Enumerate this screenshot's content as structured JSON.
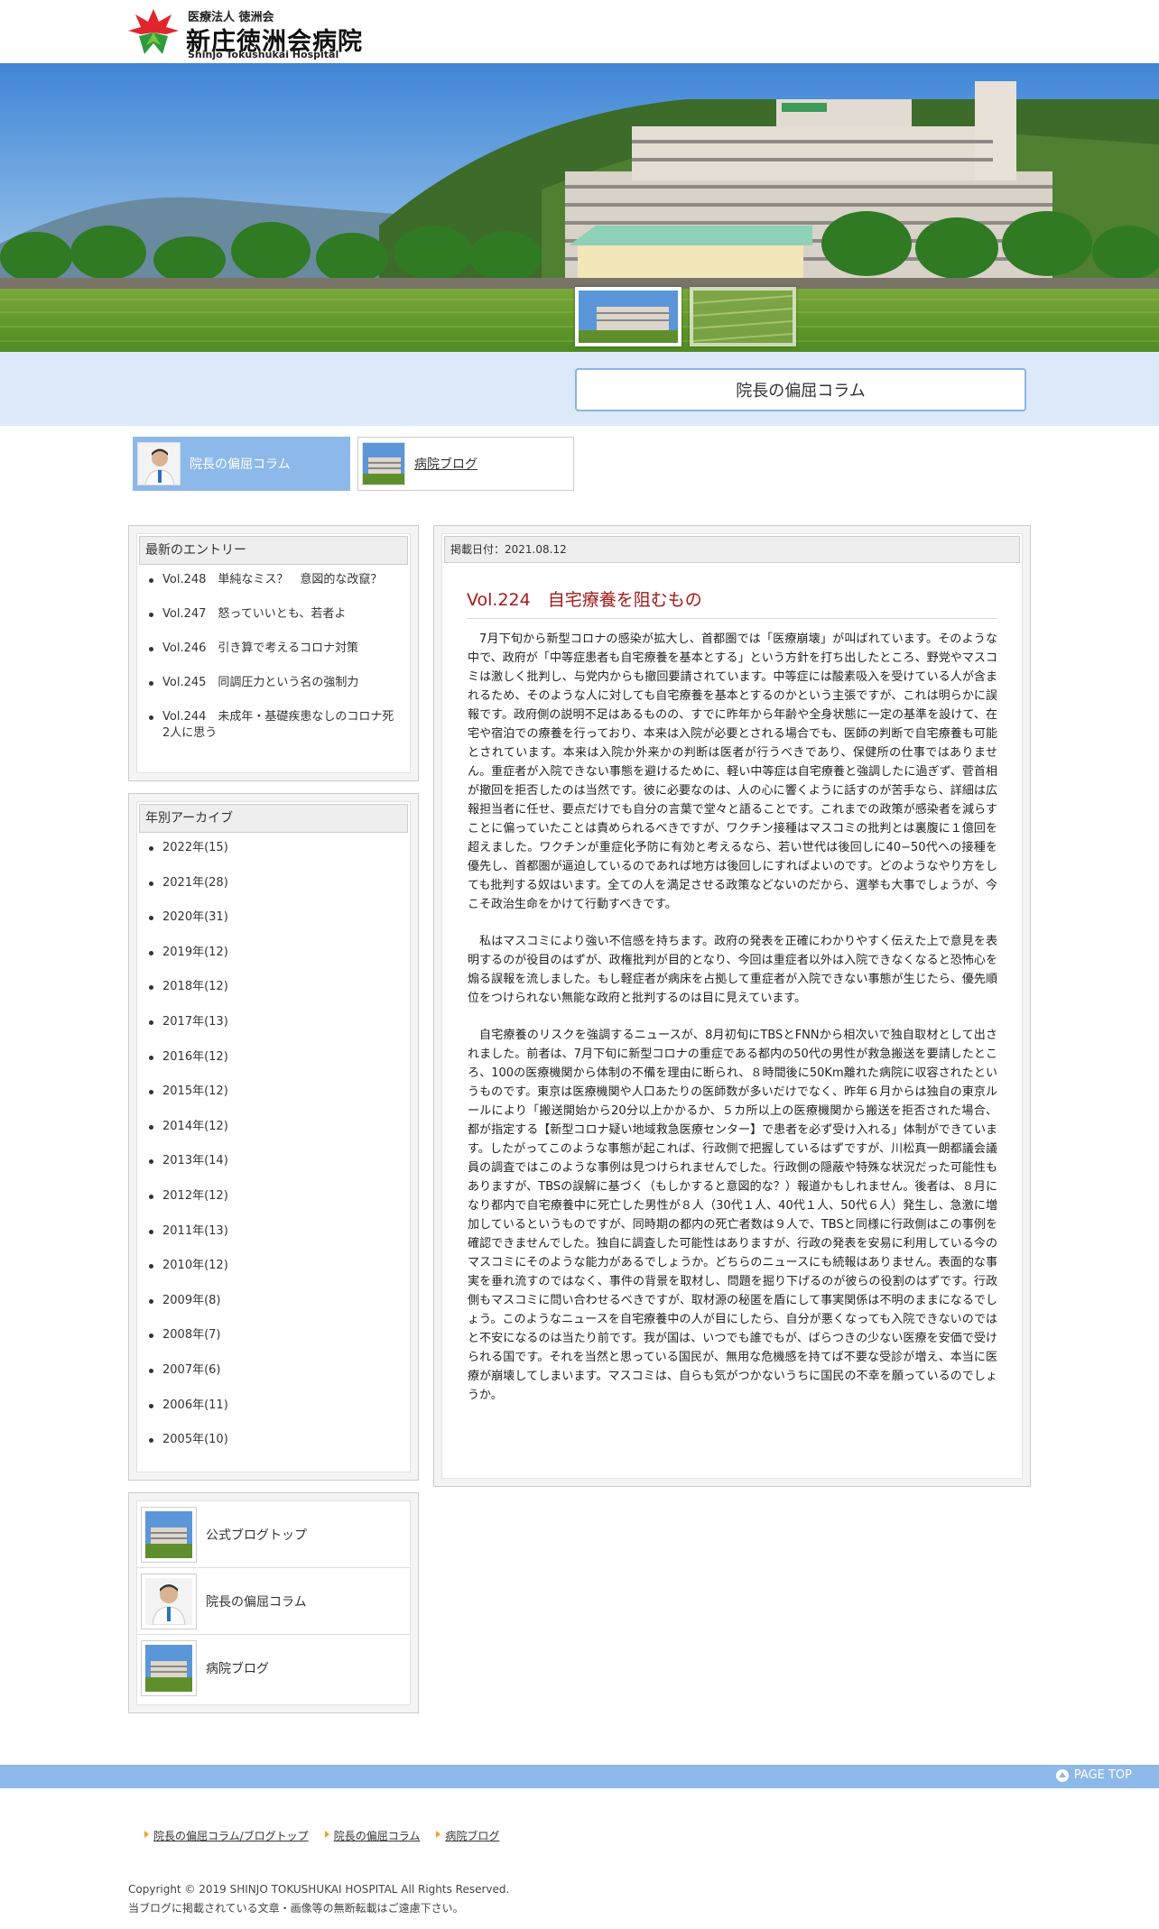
{
  "header": {
    "org": "医療法人 徳洲会",
    "name": "新庄徳洲会病院",
    "name_en": "Shinjo Tokushukai Hospital"
  },
  "band": {
    "title": "院長の偏屈コラム"
  },
  "tabs": [
    {
      "label": "院長の偏屈コラム",
      "active": true
    },
    {
      "label": "病院ブログ",
      "active": false
    }
  ],
  "entries": {
    "heading": "最新のエントリー",
    "items": [
      "Vol.248　単純なミス？　意図的な改竄？",
      "Vol.247　怒っていいとも、若者よ",
      "Vol.246　引き算で考えるコロナ対策",
      "Vol.245　同調圧力という名の強制力",
      "Vol.244　未成年・基礎疾患なしのコロナ死2人に思う"
    ]
  },
  "archive": {
    "heading": "年別アーカイブ",
    "items": [
      "2022年(15)",
      "2021年(28)",
      "2020年(31)",
      "2019年(12)",
      "2018年(12)",
      "2017年(13)",
      "2016年(12)",
      "2015年(12)",
      "2014年(12)",
      "2013年(14)",
      "2012年(12)",
      "2011年(13)",
      "2010年(12)",
      "2009年(8)",
      "2008年(7)",
      "2007年(6)",
      "2006年(11)",
      "2005年(10)"
    ]
  },
  "links": [
    "公式ブログトップ",
    "院長の偏屈コラム",
    "病院ブログ"
  ],
  "article": {
    "date": "掲載日付：2021.08.12",
    "title": "Vol.224　自宅療養を阻むもの",
    "paragraphs": [
      "7月下旬から新型コロナの感染が拡大し、首都圏では「医療崩壊」が叫ばれています。そのような中で、政府が「中等症患者も自宅療養を基本とする」という方針を打ち出したところ、野党やマスコミは激しく批判し、与党内からも撤回要請されています。中等症には酸素吸入を受けている人が含まれるため、そのような人に対しても自宅療養を基本とするのかという主張ですが、これは明らかに誤報です。政府側の説明不足はあるものの、すでに昨年から年齢や全身状態に一定の基準を設けて、在宅や宿泊での療養を行っており、本来は入院が必要とされる場合でも、医師の判断で自宅療養も可能とされています。本来は入院か外来かの判断は医者が行うべきであり、保健所の仕事ではありません。重症者が入院できない事態を避けるために、軽い中等症は自宅療養と強調したに過ぎず、菅首相が撤回を拒否したのは当然です。彼に必要なのは、人の心に響くように話すのが苦手なら、詳細は広報担当者に任せ、要点だけでも自分の言葉で堂々と語ることです。これまでの政策が感染者を減らすことに偏っていたことは責められるべきですが、ワクチン接種はマスコミの批判とは裏腹に１億回を超えました。ワクチンが重症化予防に有効と考えるなら、若い世代は後回しに40−50代への接種を優先し、首都圏が逼迫しているのであれば地方は後回しにすればよいのです。どのようなやり方をしても批判する奴はいます。全ての人を満足させる政策などないのだから、選挙も大事でしょうが、今こそ政治生命をかけて行動すべきです。",
      "私はマスコミにより強い不信感を持ちます。政府の発表を正確にわかりやすく伝えた上で意見を表明するのが役目のはずが、政権批判が目的となり、今回は重症者以外は入院できなくなると恐怖心を煽る誤報を流しました。もし軽症者が病床を占拠して重症者が入院できない事態が生じたら、優先順位をつけられない無能な政府と批判するのは目に見えています。",
      "自宅療養のリスクを強調するニュースが、8月初旬にTBSとFNNから相次いで独自取材として出されました。前者は、7月下旬に新型コロナの重症である都内の50代の男性が救急搬送を要請したところ、100の医療機関から体制の不備を理由に断られ、８時間後に50Km離れた病院に収容されたというものです。東京は医療機関や人口あたりの医師数が多いだけでなく、昨年６月からは独自の東京ルールにより「搬送開始から20分以上かかるか、５カ所以上の医療機関から搬送を拒否された場合、都が指定する【新型コロナ疑い地域救急医療センター】で患者を必ず受け入れる」体制ができています。したがってこのような事態が起これば、行政側で把握しているはずですが、川松真一朗都議会議員の調査ではこのような事例は見つけられませんでした。行政側の隠蔽や特殊な状況だった可能性もありますが、TBSの誤解に基づく（もしかすると意図的な？）報道かもしれません。後者は、８月になり都内で自宅療養中に死亡した男性が８人（30代１人、40代１人、50代６人）発生し、急激に増加しているというものですが、同時期の都内の死亡者数は９人で、TBSと同様に行政側はこの事例を確認できませんでした。独自に調査した可能性はありますが、行政の発表を安易に利用している今のマスコミにそのような能力があるでしょうか。どちらのニュースにも続報はありません。表面的な事実を垂れ流すのではなく、事件の背景を取材し、問題を掘り下げるのが彼らの役割のはずです。行政側もマスコミに問い合わせるべきですが、取材源の秘匿を盾にして事実関係は不明のままになるでしょう。このようなニュースを自宅療養中の人が目にしたら、自分が悪くなっても入院できないのではと不安になるのは当たり前です。我が国は、いつでも誰でもが、ばらつきの少ない医療を安価で受けられる国です。それを当然と思っている国民が、無用な危機感を持てば不要な受診が増え、本当に医療が崩壊してしまいます。マスコミは、自らも気がつかないうちに国民の不幸を願っているのでしょうか。"
    ]
  },
  "footer": {
    "pagetop": "PAGE TOP",
    "nav": [
      "院長の偏屈コラム/ブログトップ",
      "院長の偏屈コラム",
      "病院ブログ"
    ],
    "copyright": "Copyright © 2019 SHINJO TOKUSHUKAI HOSPITAL All Rights Reserved.",
    "notice": "当ブログに掲載されている文章・画像等の無断転載はご遠慮下さい。"
  },
  "colors": {
    "accent": "#8db9ea",
    "band": "#dbe9f8",
    "title_red": "#a41b1b",
    "logo_red": "#e0262c",
    "logo_green": "#2e9a3d"
  }
}
